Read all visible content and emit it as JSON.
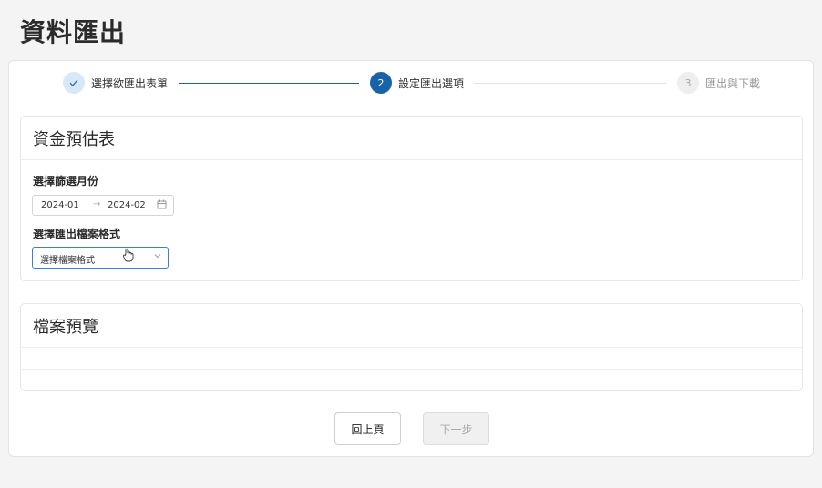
{
  "page": {
    "title": "資料匯出"
  },
  "steps": [
    {
      "number": "1",
      "label": "選擇欲匯出表單",
      "status": "done"
    },
    {
      "number": "2",
      "label": "設定匯出選項",
      "status": "active"
    },
    {
      "number": "3",
      "label": "匯出與下載",
      "status": "todo"
    }
  ],
  "settings_card": {
    "title": "資金預估表",
    "month_label": "選擇篩選月份",
    "range_start": "2024-01",
    "range_end": "2024-02",
    "format_label": "選擇匯出檔案格式",
    "format_placeholder": "選擇檔案格式"
  },
  "preview_card": {
    "title": "檔案預覽"
  },
  "footer": {
    "back_label": "回上頁",
    "next_label": "下一步"
  },
  "colors": {
    "primary": "#1663a8",
    "focus_border": "#3a7fd0"
  }
}
